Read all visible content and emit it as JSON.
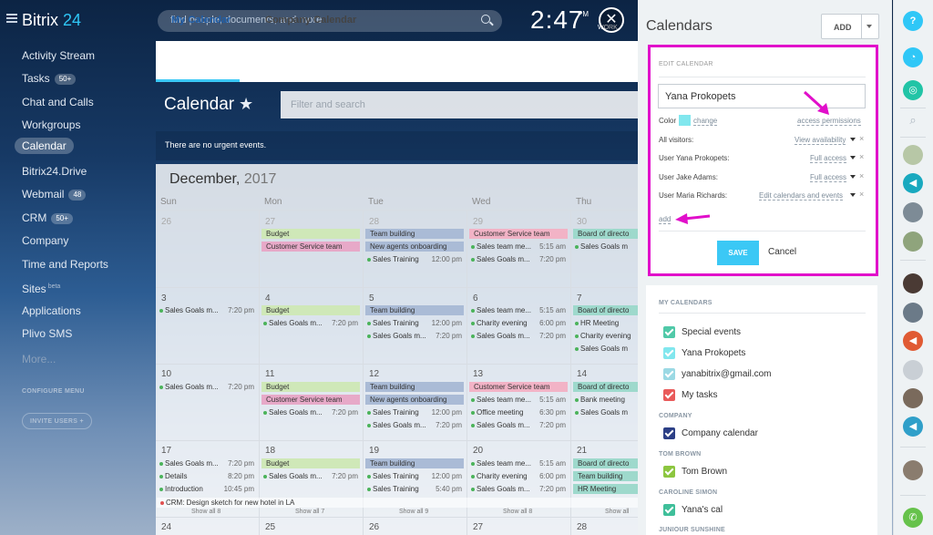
{
  "header": {
    "logo_main": "Bitrix",
    "logo_num": "24",
    "search_placeholder": "find people, documents, and more",
    "clock": "2:47",
    "clock_pm": "PM",
    "clock_work": "WORK"
  },
  "menu": {
    "items": [
      {
        "label": "Activity Stream",
        "count": ""
      },
      {
        "label": "Tasks",
        "count": "50+"
      },
      {
        "label": "Chat and Calls",
        "count": ""
      },
      {
        "label": "Workgroups",
        "count": ""
      },
      {
        "label": "Calendar",
        "count": ""
      },
      {
        "label": "Bitrix24.Drive",
        "count": ""
      },
      {
        "label": "Webmail",
        "count": "48"
      },
      {
        "label": "CRM",
        "count": "50+"
      },
      {
        "label": "Company",
        "count": ""
      },
      {
        "label": "Time and Reports",
        "count": ""
      },
      {
        "label": "Sites",
        "count": ""
      },
      {
        "label": "Applications",
        "count": ""
      },
      {
        "label": "Plivo SMS",
        "count": ""
      },
      {
        "label": "More...",
        "count": ""
      }
    ],
    "sites_beta": "beta",
    "configure": "CONFIGURE MENU",
    "invite": "INVITE USERS"
  },
  "content": {
    "tabs": [
      "My Calendar",
      "Company Calendar"
    ],
    "title": "Calendar",
    "filter_placeholder": "Filter and search",
    "urgent": "There are no urgent events.",
    "month": "December,",
    "year": "2017",
    "days_of_week": [
      "Sun",
      "Mon",
      "Tue",
      "Wed",
      "Thu"
    ],
    "weeks": [
      {
        "dates": [
          "26",
          "27",
          "28",
          "29",
          "30"
        ]
      },
      {
        "dates": [
          "3",
          "4",
          "5",
          "6",
          "7"
        ]
      },
      {
        "dates": [
          "10",
          "11",
          "12",
          "13",
          "14"
        ]
      },
      {
        "dates": [
          "17",
          "18",
          "19",
          "20",
          "21"
        ]
      },
      {
        "dates": [
          "24",
          "25",
          "26",
          "27",
          "28"
        ]
      }
    ],
    "crm_event": "CRM: Design sketch for new hotel in LA",
    "show_all": [
      "Show all 8",
      "Show all 7",
      "Show all 9",
      "Show all 8",
      "Show all"
    ]
  },
  "events": {
    "w1": {
      "mon": [
        "Budget",
        "Customer Service team"
      ],
      "tue": [
        "Team building",
        "New agents onboarding",
        "Sales Training"
      ],
      "tue_time": "12:00 pm",
      "wed": [
        "Customer Service team",
        "Sales team me...",
        "Sales Goals m..."
      ],
      "wed_times": [
        "5:15 am",
        "7:20 pm"
      ],
      "thu": [
        "Board of directo",
        "Sales Goals m"
      ]
    },
    "w2": {
      "sun": "Sales Goals m...",
      "sun_time": "7:20 pm",
      "mon": [
        "Budget",
        "Sales Goals m..."
      ],
      "mon_time": "7:20 pm",
      "tue": [
        "Team building",
        "Sales Training",
        "Sales Goals m..."
      ],
      "tue_times": [
        "12:00 pm",
        "7:20 pm"
      ],
      "wed": [
        "Sales team me...",
        "Charity evening",
        "Sales Goals m..."
      ],
      "wed_times": [
        "5:15 am",
        "6:00 pm",
        "7:20 pm"
      ],
      "thu": [
        "Board of directo",
        "HR Meeting",
        "Charity evening",
        "Sales Goals m"
      ]
    },
    "w3": {
      "sun": "Sales Goals m...",
      "sun_time": "7:20 pm",
      "mon": [
        "Budget",
        "Customer Service team",
        "Sales Goals m..."
      ],
      "mon_time": "7:20 pm",
      "tue": [
        "Team building",
        "New agents onboarding",
        "Sales Training",
        "Sales Goals m..."
      ],
      "tue_times": [
        "12:00 pm",
        "7:20 pm"
      ],
      "wed": [
        "Customer Service team",
        "Sales team me...",
        "Office meeting",
        "Sales Goals m..."
      ],
      "wed_times": [
        "5:15 am",
        "6:30 pm",
        "7:20 pm"
      ],
      "thu": [
        "Board of directo",
        "Bank meeting",
        "Sales Goals m"
      ]
    },
    "w4": {
      "sun": [
        "Sales Goals m...",
        "Details",
        "Introduction"
      ],
      "sun_times": [
        "7:20 pm",
        "8:20 pm",
        "10:45 pm"
      ],
      "mon": [
        "Budget",
        "Sales Goals m..."
      ],
      "mon_time": "7:20 pm",
      "tue": [
        "Team building",
        "Sales Training",
        "Sales Training"
      ],
      "tue_times": [
        "12:00 pm",
        "5:40 pm"
      ],
      "wed": [
        "Sales team me...",
        "Charity evening",
        "Sales Goals m..."
      ],
      "wed_times": [
        "5:15 am",
        "6:00 pm",
        "7:20 pm"
      ],
      "thu": [
        "Board of directo",
        "Team building",
        "HR Meeting"
      ]
    }
  },
  "panel": {
    "title": "Calendars",
    "add": "ADD",
    "edit_label": "EDIT CALENDAR",
    "name_value": "Yana Prokopets",
    "color_label": "Color",
    "change": "change",
    "access_permissions": "access permissions",
    "color": "#81e7ee",
    "permissions": [
      {
        "who": "All visitors:",
        "level": "View availability"
      },
      {
        "who": "User Yana Prokopets:",
        "level": "Full access"
      },
      {
        "who": "User Jake Adams:",
        "level": "Full access"
      },
      {
        "who": "User Maria Richards:",
        "level": "Edit calendars and events"
      }
    ],
    "add_link": "add",
    "save": "SAVE",
    "cancel": "Cancel",
    "my_calendars_label": "MY CALENDARS",
    "my_calendars": [
      {
        "label": "Special events",
        "color": "#50c9a8"
      },
      {
        "label": "Yana Prokopets",
        "color": "#81e7ee"
      },
      {
        "label": "yanabitrix@gmail.com",
        "color": "#9bd9e4"
      },
      {
        "label": "My tasks",
        "color": "#e95a5a"
      }
    ],
    "company_label": "COMPANY",
    "company_calendar": "Company calendar",
    "company_color": "#2c3f86",
    "tom_label": "TOM BROWN",
    "tom_calendar": "Tom Brown",
    "tom_color": "#8cc63f",
    "caroline_label": "CAROLINE SIMON",
    "caroline_calendar": "Yana's cal",
    "caroline_color": "#3fbf9a",
    "juniour_label": "JUNIOUR SUNSHINE"
  },
  "rightbar": {
    "help": "?"
  }
}
